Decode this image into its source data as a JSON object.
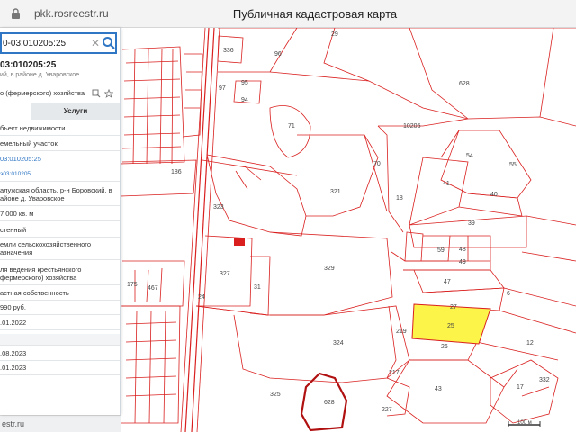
{
  "browser": {
    "url": "pkk.rosreestr.ru",
    "title": "Публичная кадастровая карта"
  },
  "search": {
    "value": "0-03:010205:25"
  },
  "object": {
    "number": "03:010205:25",
    "address": "ий, в районе д. Уваровское",
    "purpose": "о (фермерского) хозяйства"
  },
  "tabs": {
    "services": "Услуги"
  },
  "details": {
    "type": "бъект недвижимости",
    "kind": "емельный участок",
    "cad_number": "03:010205:25",
    "quarter": "э03:010205",
    "address_1": "алужская область, р-н Боровский, в",
    "address_2": "айоне д. Уваровское",
    "area": "7 000 кв. м",
    "status": "стенный",
    "category_1": "емли сельскохозяйственного",
    "category_2": "азначения",
    "use_1": "ля ведения крестьянского",
    "use_2": "фермерского) хозяйства",
    "ownership": "астная собственность",
    "cost": "990 руб.",
    "date_1": ".01.2022",
    "date_2": ".08.2023",
    "date_3": ".01.2023"
  },
  "map": {
    "scale_label": "100 м",
    "bottom_url": "estr.ru",
    "quarter_label": "10205",
    "colors": {
      "boundary": "#d9201f",
      "selected_fill": "#fdf44a",
      "accent": "#2f76c4"
    },
    "parcels": {
      "p29": "29",
      "p628": "628",
      "p336": "336",
      "p96": "96",
      "p97": "97",
      "p95": "95",
      "p94": "94",
      "p71": "71",
      "p70": "70",
      "p321": "321",
      "p18": "18",
      "p54": "54",
      "p55": "55",
      "p41": "41",
      "p40": "40",
      "p39": "39",
      "p186": "186",
      "p323": "323",
      "p59": "59",
      "p48": "48",
      "p49": "49",
      "p47": "47",
      "p327": "327",
      "p31": "31",
      "p24": "24",
      "p329": "329",
      "p27": "27",
      "p25": "25",
      "p6": "6",
      "p12": "12",
      "p26": "26",
      "p324": "324",
      "p325": "325",
      "p628b": "628",
      "p227": "227",
      "p217": "217",
      "p43": "43",
      "p17": "17",
      "p332": "332",
      "p175": "175",
      "p467": "467",
      "p219": "219"
    }
  }
}
